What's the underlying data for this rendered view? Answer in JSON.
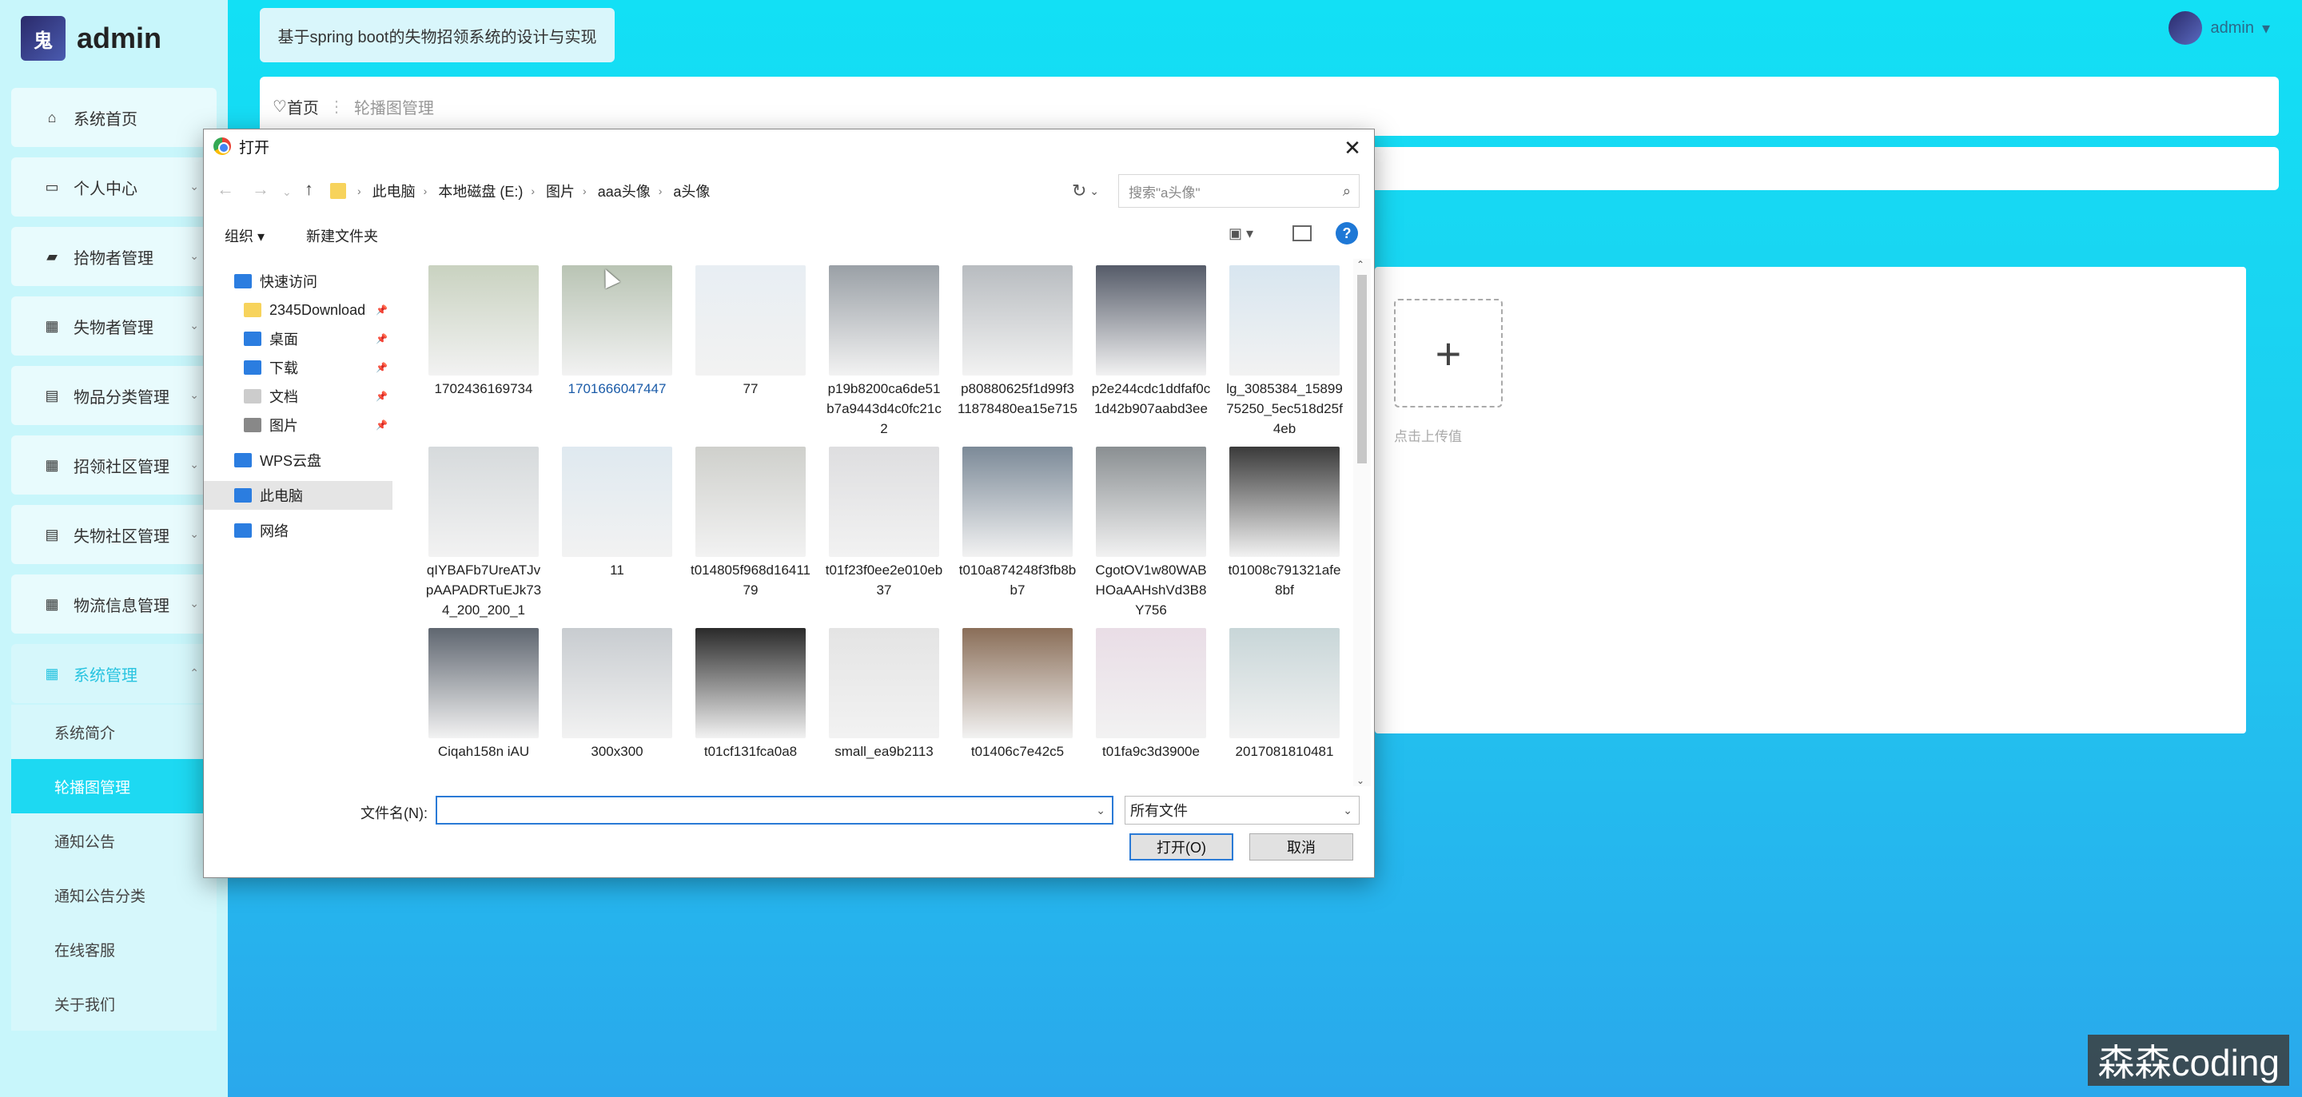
{
  "app": {
    "brand": "admin",
    "header_title": "基于spring boot的失物招领系统的设计与实现",
    "user_name": "admin",
    "breadcrumb": {
      "home": "首页",
      "current": "轮播图管理"
    },
    "upload_tip": "点击上传值",
    "watermark": "森森coding"
  },
  "sidebar": {
    "items": [
      {
        "label": "系统首页",
        "icon": "home-icon"
      },
      {
        "label": "个人中心",
        "icon": "user-card-icon"
      },
      {
        "label": "拾物者管理",
        "icon": "briefcase-icon"
      },
      {
        "label": "失物者管理",
        "icon": "grid-icon"
      },
      {
        "label": "物品分类管理",
        "icon": "clipboard-icon"
      },
      {
        "label": "招领社区管理",
        "icon": "grid-icon"
      },
      {
        "label": "失物社区管理",
        "icon": "clipboard-icon"
      },
      {
        "label": "物流信息管理",
        "icon": "grid-icon"
      },
      {
        "label": "系统管理",
        "icon": "apps-icon"
      }
    ],
    "sub_items": [
      "系统简介",
      "轮播图管理",
      "通知公告",
      "通知公告分类",
      "在线客服",
      "关于我们"
    ]
  },
  "dialog": {
    "title": "打开",
    "address": [
      "此电脑",
      "本地磁盘 (E:)",
      "图片",
      "aaa头像",
      "a头像"
    ],
    "search_placeholder": "搜索\"a头像\"",
    "toolbar": {
      "organize": "组织 ▾",
      "new_folder": "新建文件夹"
    },
    "nav": [
      {
        "label": "快速访问",
        "level": 0,
        "icon": "star-icon"
      },
      {
        "label": "2345Download",
        "level": 1,
        "icon": "folder-icon"
      },
      {
        "label": "桌面",
        "level": 1,
        "icon": "desktop-icon"
      },
      {
        "label": "下载",
        "level": 1,
        "icon": "download-icon"
      },
      {
        "label": "文档",
        "level": 1,
        "icon": "document-icon"
      },
      {
        "label": "图片",
        "level": 1,
        "icon": "pictures-icon"
      },
      {
        "label": "WPS云盘",
        "level": 0,
        "icon": "cloud-icon"
      },
      {
        "label": "此电脑",
        "level": 0,
        "icon": "computer-icon"
      },
      {
        "label": "网络",
        "level": 0,
        "icon": "network-icon"
      }
    ],
    "files": [
      {
        "name": "1702436169734",
        "color": "#c9d2c0"
      },
      {
        "name": "1701666047447",
        "color": "#b9c4b4"
      },
      {
        "name": "77",
        "color": "#e8eef3"
      },
      {
        "name": "p19b8200ca6de51b7a9443d4c0fc21c2",
        "color": "#9aa0a6"
      },
      {
        "name": "p80880625f1d99f311878480ea15e715",
        "color": "#b8bcc0"
      },
      {
        "name": "p2e244cdc1ddfaf0c1d42b907aabd3ee",
        "color": "#555b68"
      },
      {
        "name": "lg_3085384_1589975250_5ec518d25f4eb",
        "color": "#d8e6f0"
      },
      {
        "name": "qIYBAFb7UreATJvpAAPADRTuEJk734_200_200_1",
        "color": "#d6dadc"
      },
      {
        "name": "11",
        "color": "#dfe9f0"
      },
      {
        "name": "t014805f968d1641179",
        "color": "#cfd0cc"
      },
      {
        "name": "t01f23f0ee2e010eb37",
        "color": "#dedee0"
      },
      {
        "name": "t010a874248f3fb8bb7",
        "color": "#7c8a98"
      },
      {
        "name": "CgotOV1w80WABHOaAAHshVd3B8Y756",
        "color": "#8a8f92"
      },
      {
        "name": "t01008c791321afe8bf",
        "color": "#3a3a3a"
      },
      {
        "name": "Ciqah158n iAU",
        "color": "#5f6670"
      },
      {
        "name": "300x300",
        "color": "#c8ccd0"
      },
      {
        "name": "t01cf131fca0a8",
        "color": "#2a2a2a"
      },
      {
        "name": "small_ea9b2113",
        "color": "#e4e4e4"
      },
      {
        "name": "t01406c7e42c5",
        "color": "#8a6e58"
      },
      {
        "name": "t01fa9c3d3900e",
        "color": "#e9dde6"
      },
      {
        "name": "2017081810481",
        "color": "#c8d6d8"
      }
    ],
    "filename_label": "文件名(N):",
    "filename_value": "",
    "filetype": "所有文件",
    "open_button": "打开(O)",
    "cancel_button": "取消"
  }
}
